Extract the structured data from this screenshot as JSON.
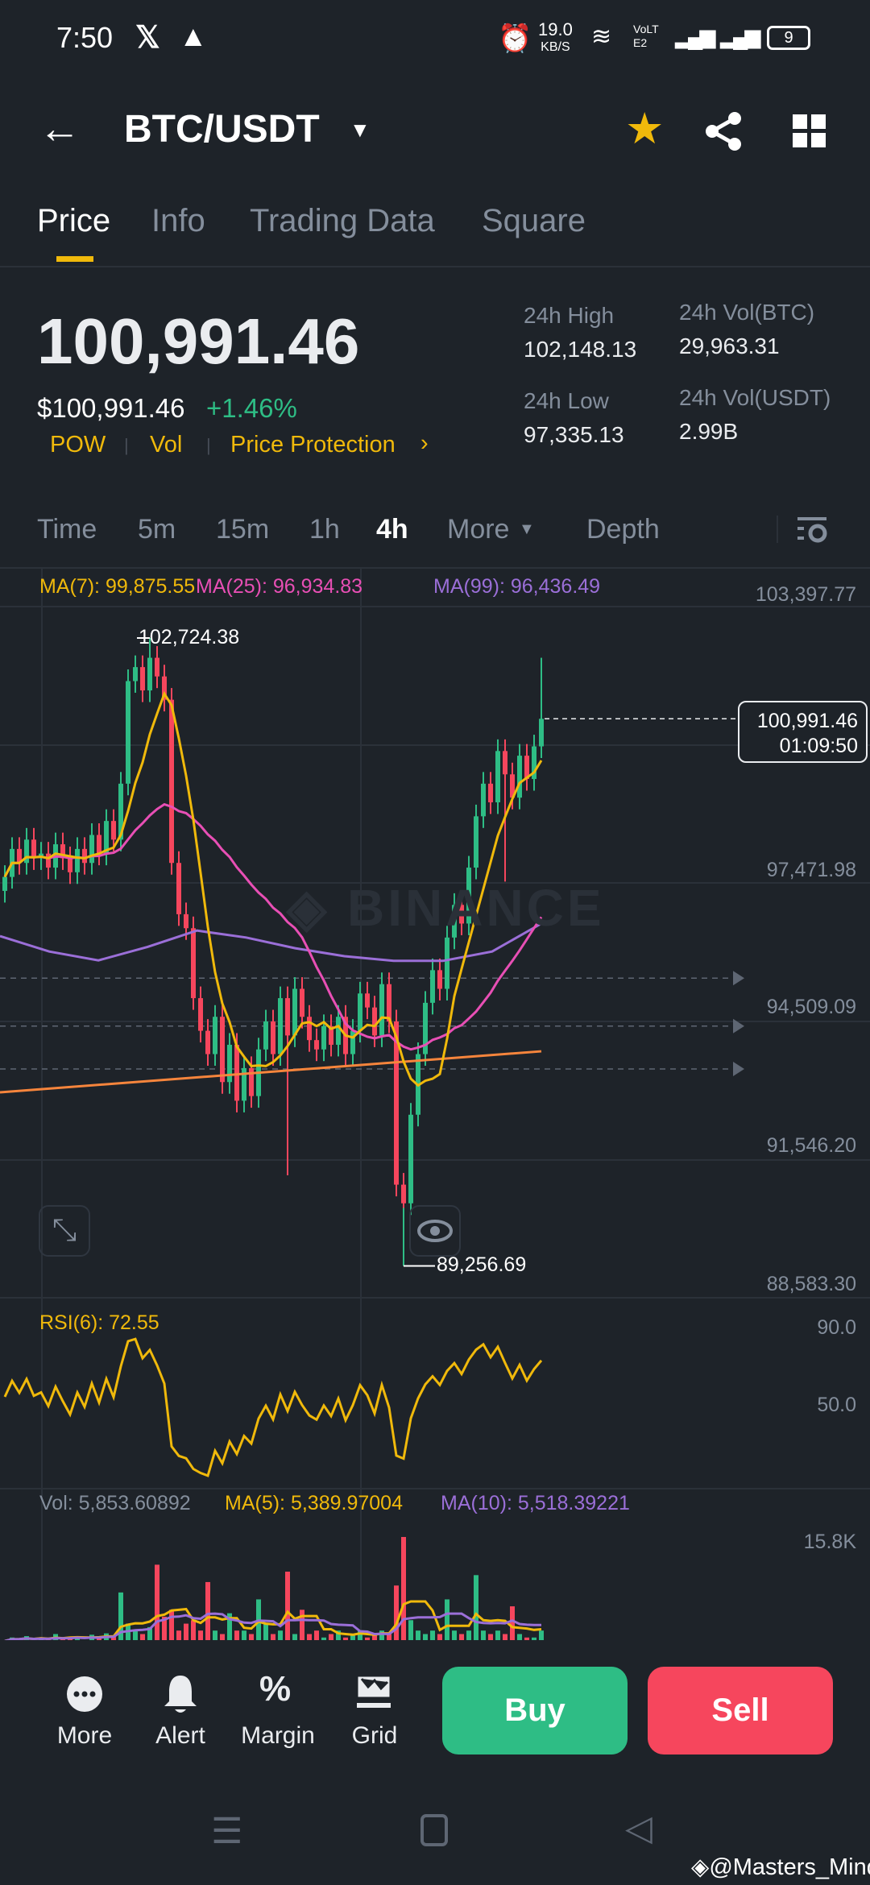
{
  "status_bar": {
    "time": "7:50",
    "net_speed": "19.0",
    "net_unit": "KB/S",
    "volte": "VoLTE2",
    "battery": "9"
  },
  "header": {
    "pair": "BTC/USDT"
  },
  "tabs": [
    {
      "label": "Price"
    },
    {
      "label": "Info"
    },
    {
      "label": "Trading Data"
    },
    {
      "label": "Square"
    }
  ],
  "ticker": {
    "last_price": "100,991.46",
    "usd_price": "$100,991.46",
    "change": "+1.46%",
    "tags": [
      "POW",
      "Vol",
      "Price Protection"
    ],
    "high_label": "24h High",
    "high": "102,148.13",
    "low_label": "24h Low",
    "low": "97,335.13",
    "vol_btc_label": "24h Vol(BTC)",
    "vol_btc": "29,963.31",
    "vol_usdt_label": "24h Vol(USDT)",
    "vol_usdt": "2.99B"
  },
  "intervals": [
    {
      "label": "Time"
    },
    {
      "label": "5m"
    },
    {
      "label": "15m"
    },
    {
      "label": "1h"
    },
    {
      "label": "4h"
    },
    {
      "label": "More"
    },
    {
      "label": "Depth"
    }
  ],
  "indicators": {
    "ma7": "MA(7): 99,875.55",
    "ma25": "MA(25): 96,934.83",
    "ma99": "MA(99): 96,436.49",
    "rsi": "RSI(6): 72.55",
    "vol": "Vol: 5,853.60892",
    "vol_ma5": "MA(5): 5,389.97004",
    "vol_ma10": "MA(10): 5,518.39221"
  },
  "price_axis": [
    "103,397.77",
    "97,471.98",
    "94,509.09",
    "91,546.20",
    "88,583.30"
  ],
  "rsi_axis": [
    "90.0",
    "50.0"
  ],
  "vol_axis": "15.8K",
  "markers": {
    "high": "102,724.38",
    "low": "89,256.69",
    "last": "100,991.46",
    "countdown": "01:09:50"
  },
  "colors": {
    "up": "#2ebd85",
    "down": "#f6465d",
    "ma7": "#f0b90b",
    "ma25": "#e84fb5",
    "ma99": "#9b6fd8",
    "trend": "#f7853c"
  },
  "chart_data": {
    "type": "candlestick",
    "interval": "4h",
    "ylim": [
      88583.3,
      103397.77
    ],
    "closes": [
      97600,
      98200,
      97900,
      98400,
      98000,
      98100,
      97800,
      98300,
      98000,
      97700,
      98200,
      97900,
      98500,
      98100,
      98800,
      98400,
      99600,
      101800,
      102100,
      101600,
      102300,
      101900,
      101400,
      97900,
      96800,
      96500,
      95000,
      94300,
      93800,
      94600,
      93200,
      94000,
      92800,
      93500,
      92900,
      93900,
      94500,
      93800,
      95000,
      94200,
      95200,
      94600,
      94100,
      93900,
      94400,
      94000,
      94600,
      93800,
      94300,
      95100,
      94800,
      94200,
      95300,
      94500,
      91000,
      90600,
      92500,
      93800,
      94900,
      95600,
      95200,
      96300,
      97000,
      96600,
      97800,
      98900,
      99600,
      99200,
      100300,
      99800,
      99300,
      100200,
      99700,
      100400,
      100991.46
    ],
    "first_open": 97300,
    "overrides": [
      {
        "index": 20,
        "high": 102724.38
      },
      {
        "index": 55,
        "low": 89256.69
      },
      {
        "index": 74,
        "high": 102300
      },
      {
        "index": 69,
        "low": 97500
      },
      {
        "index": 39,
        "low": 91200
      }
    ],
    "ma99": [
      96330,
      96000,
      95810,
      96100,
      96450,
      96300,
      96070,
      95900,
      95800,
      95800,
      96000,
      96600
    ],
    "trendline": [
      92980,
      93860
    ],
    "alert_levels": [
      95430,
      94400,
      93480
    ],
    "volumes_k": [
      1.5,
      2,
      1.8,
      2.2,
      1.5,
      2,
      1.7,
      2.5,
      1.8,
      2,
      2.2,
      1.6,
      2.4,
      2,
      2.6,
      2.2,
      8.5,
      4,
      3,
      2.5,
      3.5,
      12.5,
      5,
      6,
      3,
      4,
      4.5,
      3,
      10,
      3,
      2.5,
      5.5,
      3,
      3,
      2.5,
      7.5,
      4,
      2.5,
      3,
      11.5,
      2.5,
      6,
      2.5,
      3,
      2,
      2.5,
      3,
      2,
      2.5,
      3,
      2,
      2.5,
      3,
      2.5,
      9.5,
      16.5,
      4.5,
      3,
      2.5,
      3,
      2.5,
      7.5,
      3,
      2.5,
      3,
      11,
      3,
      2.5,
      3,
      2.5,
      6.5,
      2.5,
      2,
      2,
      3
    ]
  },
  "bottom_bar": {
    "more": "More",
    "alert": "Alert",
    "margin": "Margin",
    "grid": "Grid",
    "buy": "Buy",
    "sell": "Sell"
  },
  "watermark": {
    "brand": "BINANCE",
    "credit": "@Masters_Mind"
  }
}
